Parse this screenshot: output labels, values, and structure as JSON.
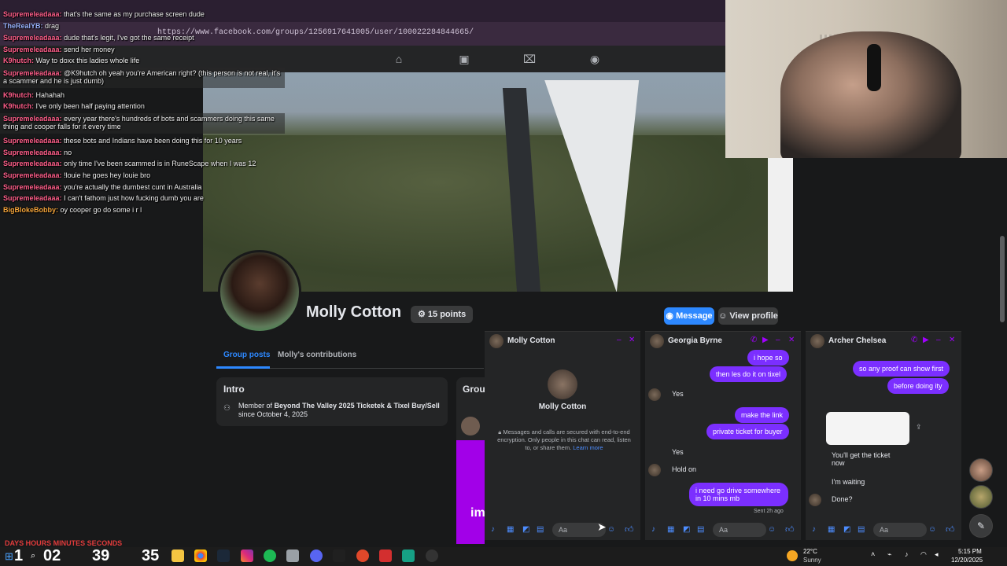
{
  "browser": {
    "url": "https://www.facebook.com/groups/1256917641005/user/100022284844665/"
  },
  "profile": {
    "name": "Molly Cotton",
    "points": "15 points",
    "message_label": "Message",
    "view_profile_label": "View profile",
    "tabs": [
      "Group posts",
      "Molly's contributions"
    ],
    "intro_title": "Intro",
    "intro_text_prefix": "Member of",
    "intro_group": "Beyond The Valley 2025 Ticketek & Tixel Buy/Sell",
    "intro_since": "since October 4, 2025",
    "group_title": "Grou",
    "purple_text": "im"
  },
  "chats": {
    "chat1": {
      "name": "Molly Cotton",
      "center_name": "Molly Cotton",
      "encryption": "Messages and calls are secured with end-to-end encryption. Only people in this chat can read, listen to, or share them.",
      "learn_more": "Learn more",
      "placeholder": "Aa"
    },
    "chat2": {
      "name": "Georgia Byrne",
      "messages": {
        "m1": "i hope so",
        "m2": "then les do it on tixel",
        "m3": "Yes",
        "m4": "make the link",
        "m5": "private ticket for buyer",
        "m6": "Yes",
        "m7": "Hold on",
        "m8": "i need go drive somewhere in 10 mins mb",
        "sent": "Sent 2h ago"
      },
      "placeholder": "Aa"
    },
    "chat3": {
      "name": "Archer Chelsea",
      "messages": {
        "m1": "so any proof can show first",
        "m2": "before doing ity",
        "m3": "You'll get the ticket now",
        "m4": "I'm waiting",
        "m5": "Done?"
      },
      "placeholder": "Aa"
    }
  },
  "overlay_chat": [
    {
      "user": "TheRealYB:",
      "text": "drag"
    },
    {
      "user": "Supremeleadaaa:",
      "text": "that's the same as my purchase screen dude"
    },
    {
      "user": "Supremeleadaaa:",
      "text": "dude that's legit, I've got the same receipt"
    },
    {
      "user": "Supremeleadaaa:",
      "text": "send her money"
    },
    {
      "user": "K9hutch:",
      "text": "Way to doxx this ladies whole life"
    },
    {
      "user": "Supremeleadaaa:",
      "text": "@K9hutch oh yeah you're American right? (this person is not real, it's a scammer and he is just dumb)"
    },
    {
      "user": "K9hutch:",
      "text": "Hahahah"
    },
    {
      "user": "K9hutch:",
      "text": "I've only been half paying attention"
    },
    {
      "user": "Supremeleadaaa:",
      "text": "every year there's hundreds of bots and scammers doing this same thing and cooper falls for it every time"
    },
    {
      "user": "Supremeleadaaa:",
      "text": "these bots and Indians have been doing this for 10 years"
    },
    {
      "user": "Supremeleadaaa:",
      "text": "no"
    },
    {
      "user": "Supremeleadaaa:",
      "text": "only time I've been scammed is in RuneScape when I was 12"
    },
    {
      "user": "Supremeleadaaa:",
      "text": "!louie he goes hey louie bro"
    },
    {
      "user": "Supremeleadaaa:",
      "text": "you're actually the dumbest cunt in Australia"
    },
    {
      "user": "Supremeleadaaa:",
      "text": "I can't fathom just how fucking dumb you are"
    },
    {
      "user": "BigBlokeBobby:",
      "text": "oy cooper go do some i r l"
    }
  ],
  "timer": {
    "labels": "DAYS   HOURS   MINUTES   SECONDS",
    "days": "1",
    "hours": "02",
    "minutes": "39",
    "seconds": "35"
  },
  "taskbar": {
    "temp": "22°C",
    "condition": "Sunny",
    "time": "5:15 PM",
    "date": "12/20/2025"
  },
  "colors": {
    "accent": "#2d88ff",
    "messenger_purple": "#7b2fff",
    "overlay_user": "#ff5e8a"
  }
}
